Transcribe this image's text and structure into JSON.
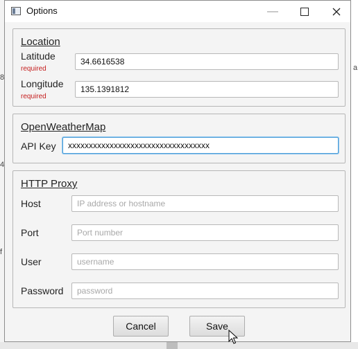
{
  "window": {
    "title": "Options"
  },
  "location": {
    "title": "Location",
    "latitude": {
      "label": "Latitude",
      "required": "required",
      "value": "34.6616538"
    },
    "longitude": {
      "label": "Longitude",
      "required": "required",
      "value": "135.1391812"
    }
  },
  "owm": {
    "title": "OpenWeatherMap",
    "api_key": {
      "label": "API Key",
      "value": "xxxxxxxxxxxxxxxxxxxxxxxxxxxxxxxxxx"
    }
  },
  "proxy": {
    "title": "HTTP Proxy",
    "host": {
      "label": "Host",
      "placeholder": "IP address or hostname"
    },
    "port": {
      "label": "Port",
      "placeholder": "Port number"
    },
    "user": {
      "label": "User",
      "placeholder": "username"
    },
    "password": {
      "label": "Password",
      "placeholder": "password"
    }
  },
  "buttons": {
    "cancel": "Cancel",
    "save": "Save"
  },
  "background": {
    "glyph_1": "8",
    "glyph_2": "4",
    "glyph_3": "f",
    "glyph_4": "a"
  },
  "colors": {
    "focus": "#4f9fd8",
    "required": "#c51d1d"
  }
}
